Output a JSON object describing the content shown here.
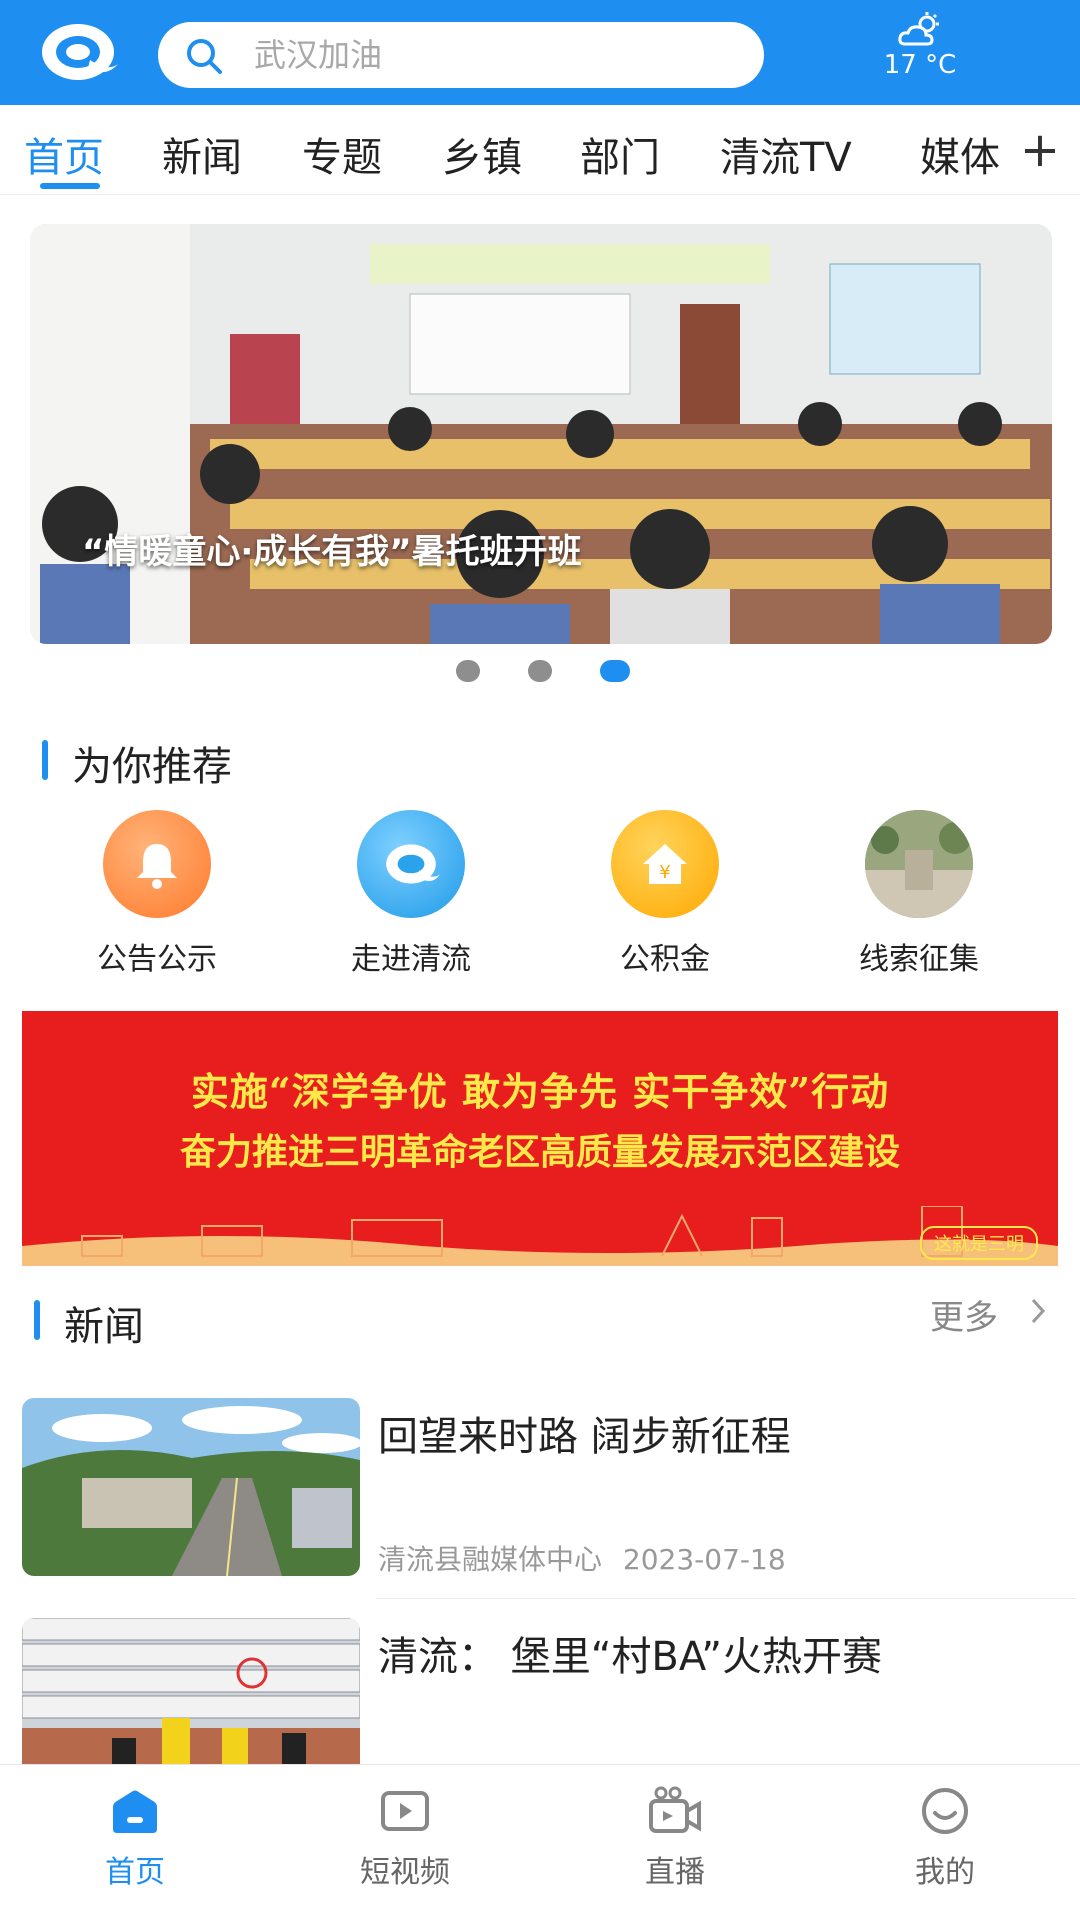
{
  "header": {
    "search_placeholder": "武汉加油",
    "weather_temp": "17 °C"
  },
  "tabs": [
    {
      "label": "首页",
      "active": true
    },
    {
      "label": "新闻"
    },
    {
      "label": "专题"
    },
    {
      "label": "乡镇"
    },
    {
      "label": "部门"
    },
    {
      "label": "清流TV"
    },
    {
      "label": "媒体"
    }
  ],
  "tab_more": "+",
  "banner": {
    "caption": "“情暖童心·成长有我”暑托班开班",
    "slide_count": 3,
    "active_slide": 3
  },
  "recommend": {
    "title": "为你推荐",
    "items": [
      {
        "label": "公告公示",
        "icon": "bell-icon",
        "color": "#ff8a3d"
      },
      {
        "label": "走进清流",
        "icon": "app-logo-icon",
        "color": "#2fa8f0"
      },
      {
        "label": "公积金",
        "icon": "house-yuan-icon",
        "color": "#ffb400"
      },
      {
        "label": "线索征集",
        "icon": "photo-thumb-icon",
        "color": "#9aa07a"
      }
    ]
  },
  "promo": {
    "line1": "实施“深学争优 敢为争先 实干争效”行动",
    "line2": "奋力推进三明革命老区高质量发展示范区建设",
    "stamp": "这就是三明"
  },
  "news": {
    "title": "新闻",
    "more": "更多",
    "items": [
      {
        "title": "回望来时路 阔步新征程",
        "source": "清流县融媒体中心",
        "date": "2023-07-18"
      },
      {
        "title": "清流： 堡里“村BA”火热开赛"
      }
    ]
  },
  "bottom_nav": [
    {
      "label": "首页",
      "icon": "home-icon",
      "active": true
    },
    {
      "label": "短视频",
      "icon": "video-play-icon"
    },
    {
      "label": "直播",
      "icon": "live-camera-icon"
    },
    {
      "label": "我的",
      "icon": "smiley-icon"
    }
  ],
  "colors": {
    "accent": "#1e8ff0",
    "promo_red": "#e81e1e",
    "promo_text": "#ffe94a"
  }
}
